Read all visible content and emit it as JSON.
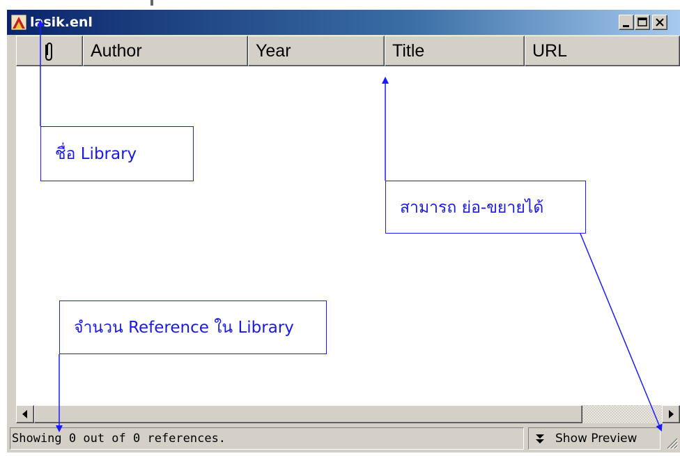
{
  "window": {
    "title": "lasik.enl",
    "icon": "endnote-library-icon",
    "buttons": {
      "minimize": "minimize-icon",
      "maximize": "maximize-icon",
      "close": "close-icon"
    }
  },
  "columns": [
    {
      "label": "",
      "icon": "paperclip-icon"
    },
    {
      "label": "Author"
    },
    {
      "label": "Year"
    },
    {
      "label": "Title"
    },
    {
      "label": "URL"
    }
  ],
  "status": {
    "text": "Showing 0 out of 0 references.",
    "preview_label": "Show Preview"
  },
  "callouts": {
    "library_name": "ชื่อ Library",
    "resizable": "สามารถ ย่อ-ขยายได้",
    "reference_count": "จำนวน Reference ใน Library"
  },
  "colors": {
    "callout_border": "#1a1aff",
    "callout_text": "#1a1ae6",
    "titlebar_start": "#0a246a",
    "titlebar_end": "#a6caf0",
    "window_face": "#d4d0c8"
  }
}
